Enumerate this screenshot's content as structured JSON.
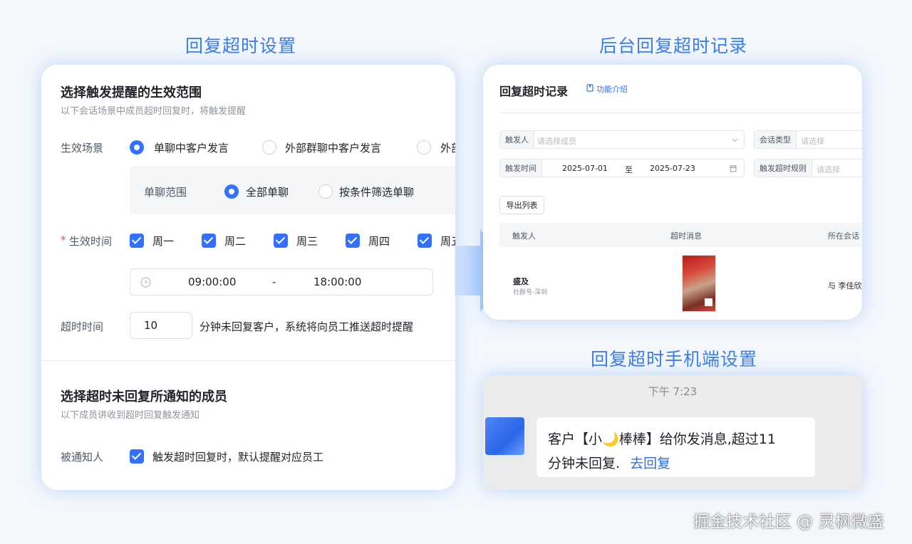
{
  "titles": {
    "left": "回复超时设置",
    "right_top": "后台回复超时记录",
    "right_bottom": "回复超时手机端设置"
  },
  "left_card": {
    "section1_title": "选择触发提醒的生效范围",
    "section1_sub": "以下会话场景中成员超时回复时，将触发提醒",
    "scene_label": "生效场景",
    "scene_options": [
      "单聊中客户发言",
      "外部群聊中客户发言",
      "外部"
    ],
    "scene_selected": 0,
    "range_label": "单聊范围",
    "range_options": [
      "全部单聊",
      "按条件筛选单聊"
    ],
    "time_label": "生效时间",
    "required_mark": "*",
    "weekdays": [
      "周一",
      "周二",
      "周三",
      "周四",
      "周五"
    ],
    "time_start": "09:00:00",
    "time_sep": "-",
    "time_end": "18:00:00",
    "timeout_label": "超时时间",
    "timeout_value": "10",
    "timeout_suffix": "分钟未回复客户，系统将向员工推送超时提醒",
    "section2_title": "选择超时未回复所通知的成员",
    "section2_sub": "以下成员讲收到超时回复触发通知",
    "notify_label": "被通知人",
    "notify_text": "触发超时回复时，默认提醒对应员工"
  },
  "records": {
    "title": "回复超时记录",
    "intro_link": "功能介绍",
    "filters": {
      "trigger_person_label": "触发人",
      "trigger_person_placeholder": "请选择成员",
      "session_type_label": "会话类型",
      "session_type_placeholder": "请选择",
      "trigger_time_label": "触发时间",
      "date_from": "2025-07-01",
      "date_to_word": "至",
      "date_to": "2025-07-23",
      "rule_label": "触发超时规则",
      "rule_placeholder": "请选择"
    },
    "export_button": "导出列表",
    "columns": [
      "触发人",
      "超时消息",
      "所在会话"
    ],
    "row": {
      "name": "盛及",
      "group": "社群号-深圳",
      "session": "与 李佳欣"
    }
  },
  "mobile": {
    "time": "下午 7:23",
    "message_line1_a": "客户【小",
    "moon": "🌙",
    "message_line1_b": "棒棒】给你发消息,超过11",
    "message_line2": "分钟未回复.",
    "reply_link": "去回复"
  },
  "watermark": "掘金技术社区 @ 灵枫微盛",
  "colors": {
    "accent": "#3370ff",
    "title_blue": "#3b7cf0"
  }
}
